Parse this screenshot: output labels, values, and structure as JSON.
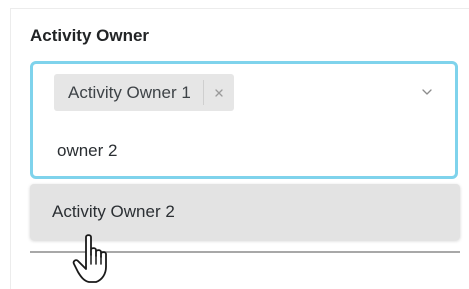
{
  "field": {
    "label": "Activity Owner"
  },
  "select": {
    "selected_chips": [
      {
        "label": "Activity Owner 1",
        "remove_icon": "close-icon"
      }
    ],
    "search_value": "owner 2",
    "dropdown_icon": "chevron-down-icon",
    "focus_color": "#7fd3ec"
  },
  "menu": {
    "options": [
      {
        "label": "Activity Owner 2",
        "highlighted": true
      }
    ]
  },
  "cursor": {
    "icon": "hand-pointer-icon"
  }
}
